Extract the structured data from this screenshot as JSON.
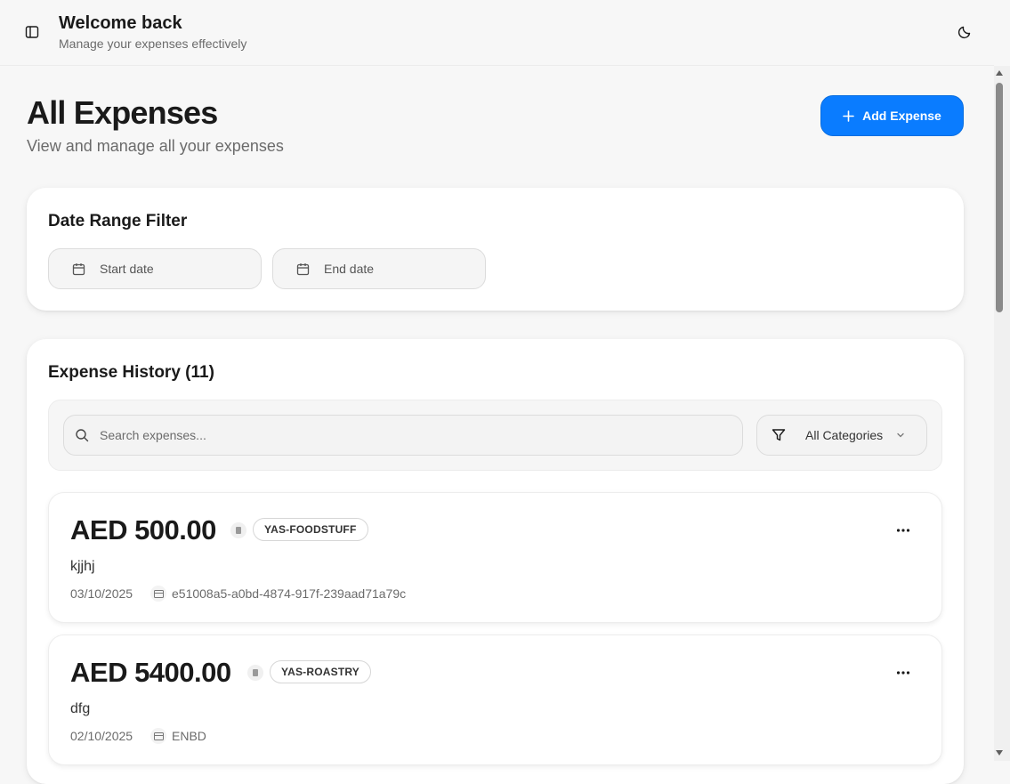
{
  "header": {
    "title": "Welcome back",
    "subtitle": "Manage your expenses effectively",
    "sidebar_toggle_icon": "panel-left-icon",
    "theme_toggle_icon": "moon-icon"
  },
  "page": {
    "title": "All Expenses",
    "subtitle": "View and manage all your expenses",
    "add_button_label": "Add Expense",
    "add_button_icon": "plus-icon",
    "accent_color": "#0a7cff"
  },
  "date_filter": {
    "heading": "Date Range Filter",
    "start_placeholder": "Start date",
    "end_placeholder": "End date",
    "icon": "calendar-icon"
  },
  "history": {
    "heading": "Expense History (11)",
    "search_placeholder": "Search expenses...",
    "category_select": "All Categories",
    "expenses": [
      {
        "amount": "AED 500.00",
        "category": "YAS-FOODSTUFF",
        "description": "kjjhj",
        "date": "03/10/2025",
        "reference": "e51008a5-a0bd-4874-917f-239aad71a79c"
      },
      {
        "amount": "AED 5400.00",
        "category": "YAS-ROASTRY",
        "description": "dfg",
        "date": "02/10/2025",
        "reference": "ENBD"
      }
    ]
  }
}
